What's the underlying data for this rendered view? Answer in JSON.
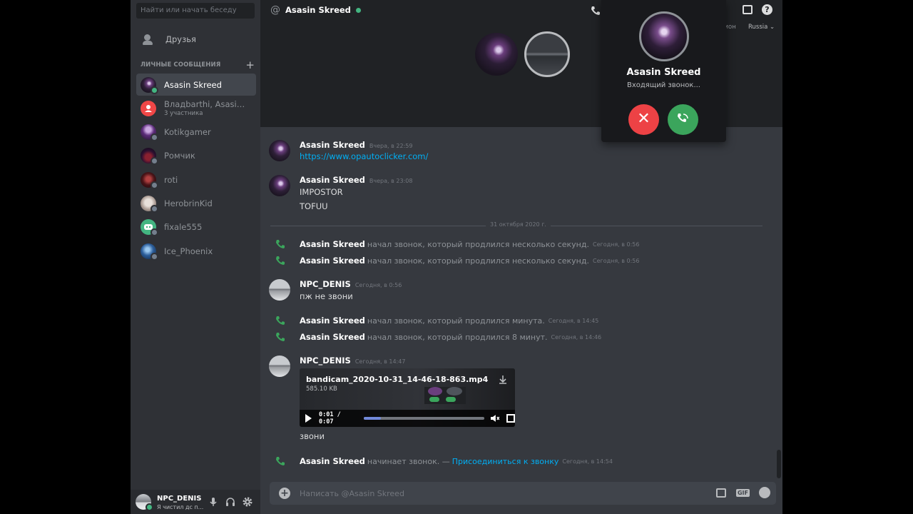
{
  "sidebar": {
    "search_placeholder": "Найти или начать беседу",
    "friends_label": "Друзья",
    "dm_header": "ЛИЧНЫЕ СООБЩЕНИЯ",
    "dm_add": "+",
    "items": [
      {
        "name": "Asasin Skreed",
        "sub": "",
        "status": "online",
        "active": true
      },
      {
        "name": "Владbarthi, Asasin S...",
        "sub": "3 участника",
        "status": "",
        "active": false
      },
      {
        "name": "Kotikgamer",
        "sub": "",
        "status": "offline",
        "active": false
      },
      {
        "name": "Ромчик",
        "sub": "",
        "status": "offline",
        "active": false
      },
      {
        "name": "roti",
        "sub": "",
        "status": "offline",
        "active": false
      },
      {
        "name": "HerobrinKid",
        "sub": "",
        "status": "offline",
        "active": false
      },
      {
        "name": "fixale555",
        "sub": "",
        "status": "offline",
        "active": false
      },
      {
        "name": "Ice_Phoenix",
        "sub": "",
        "status": "offline",
        "active": false
      }
    ],
    "user": {
      "name": "NPC_DENIS",
      "status": "Я чистил дс п..."
    }
  },
  "header": {
    "title": "Asasin Skreed",
    "region_fragment": "гион",
    "region": "Russia"
  },
  "incoming_call": {
    "name": "Asasin Skreed",
    "status": "Входящий звонок..."
  },
  "messages": {
    "m1": {
      "author": "Asasin Skreed",
      "time": "Вчера, в 22:59",
      "link": "https://www.opautoclicker.com/"
    },
    "m2": {
      "author": "Asasin Skreed",
      "time": "Вчера, в 23:08",
      "line1": "IMPOSTOR",
      "line2": "TOFUU"
    },
    "divider": "31 октября 2020 г.",
    "s1": {
      "author": "Asasin Skreed",
      "text": "начал звонок, который продлился несколько секунд.",
      "time": "Сегодня, в 0:56"
    },
    "s2": {
      "author": "Asasin Skreed",
      "text": "начал звонок, который продлился несколько секунд.",
      "time": "Сегодня, в 0:56"
    },
    "m3": {
      "author": "NPC_DENIS",
      "time": "Сегодня, в 0:56",
      "line1": "пж не звони"
    },
    "s3": {
      "author": "Asasin Skreed",
      "text": "начал звонок, который продлился минута.",
      "time": "Сегодня, в 14:45"
    },
    "s4": {
      "author": "Asasin Skreed",
      "text": "начал звонок, который продлился 8 минут.",
      "time": "Сегодня, в 14:46"
    },
    "m4": {
      "author": "NPC_DENIS",
      "time": "Сегодня, в 14:47",
      "video": {
        "filename": "bandicam_2020-10-31_14-46-18-863.mp4",
        "size": "585.10 KB",
        "timecode": "0:01 / 0:07",
        "progress": 0.14
      },
      "line1": "звони"
    },
    "s5": {
      "author": "Asasin Skreed",
      "text": "начинает звонок. —",
      "join": "Присоединиться к звонку",
      "time": "Сегодня, в 14:54"
    }
  },
  "composer": {
    "placeholder": "Написать @Asasin Skreed",
    "gif_label": "GIF"
  },
  "colors": {
    "accent_green": "#3ba55c",
    "decline_red": "#ed4245",
    "link_blue": "#00aff4",
    "online": "#43b581"
  }
}
